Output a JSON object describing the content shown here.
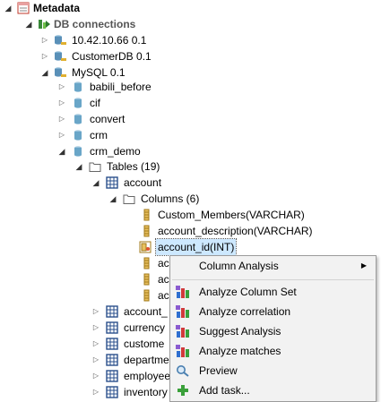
{
  "tree": {
    "metadata": "Metadata",
    "db_connections": "DB connections",
    "conn1": "10.42.10.66 0.1",
    "conn2": "CustomerDB 0.1",
    "conn3": "MySQL 0.1",
    "db1": "babili_before",
    "db2": "cif",
    "db3": "convert",
    "db4": "crm",
    "db5": "crm_demo",
    "tables": "Tables (19)",
    "account": "account",
    "columns": "Columns (6)",
    "col1": "Custom_Members(VARCHAR)",
    "col2": "account_description(VARCHAR)",
    "col3": "account_id(INT)",
    "col4": "ac",
    "col5": "ac",
    "col6": "ac",
    "t2": "account_",
    "t3": "currency",
    "t4": "custome",
    "t5": "departme",
    "t6": "employee",
    "t7": "inventory"
  },
  "menu": {
    "column_analysis": "Column Analysis",
    "analyze_column_set": "Analyze Column Set",
    "analyze_correlation": "Analyze correlation",
    "suggest_analysis": "Suggest Analysis",
    "analyze_matches": "Analyze matches",
    "preview": "Preview",
    "add_task": "Add task..."
  },
  "icons": {
    "expand": "triangle-right",
    "collapse": "triangle-down",
    "submenu": "triangle-right"
  },
  "colors": {
    "selection": "#cde8ff",
    "menu_bg": "#f2f2f2",
    "db_icon": "#6aa6c8",
    "table_icon": "#2a4f8c",
    "column_icon": "#c89a2a"
  }
}
